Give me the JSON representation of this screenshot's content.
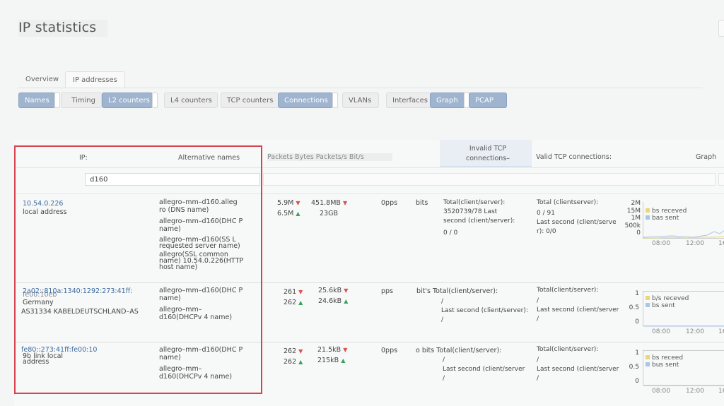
{
  "page": {
    "title": "IP statistics"
  },
  "tabs": [
    {
      "label": "Overview"
    },
    {
      "label": "IP addresses"
    }
  ],
  "buttons": [
    {
      "label": "Names",
      "active": true
    },
    {
      "label": "Timing",
      "active": false
    },
    {
      "label": "L2 counters",
      "active": true
    },
    {
      "label": "L4 counters",
      "active": false
    },
    {
      "label": "TCP counters",
      "active": false
    },
    {
      "label": "Connections",
      "active": true
    },
    {
      "label": "VLANs",
      "active": false
    },
    {
      "label": "Interfaces",
      "active": false
    },
    {
      "label": "Graph",
      "active": true
    },
    {
      "label": "PCAP",
      "active": true
    }
  ],
  "table": {
    "headers": {
      "ip": "IP:",
      "alt": "Alternative names",
      "counters": "Packets Bytes Packets/s Bit/s",
      "invalid": "Invalid TCP connections–",
      "valid": "Valid TCP connections:",
      "graph": "Graph"
    },
    "filter_value": "d160",
    "rows": [
      {
        "ip": "10.54.0.226",
        "ip_sub": "local address",
        "names": [
          "allegro–mm–d160.alleg ro (DNS name)",
          "allegro–mm–d160(DHC P name)",
          "allegro–mm–d160(SS L requested server name)",
          "allegro(SSL common name) 10.54.0.226(HTTP host name)"
        ],
        "packets": [
          "5.9M",
          "6.5M"
        ],
        "bytes": [
          "451.8MB",
          "23GB"
        ],
        "pps": "0pps",
        "bits": "bits",
        "invalid": [
          "Total(client/server):",
          "3520739/78 Last",
          "second (client/server):",
          "0 / 0"
        ],
        "valid": [
          "Total (clientserver):",
          "0 / 91",
          "Last second (client/serve",
          "r): 0/0"
        ],
        "graph_ticks_y": [
          "2M",
          "15M",
          "1M",
          "500k",
          "0"
        ],
        "graph_ticks_x": [
          "08:00",
          "12:00",
          "16"
        ],
        "legend": [
          "bs receved",
          "bas sent"
        ]
      },
      {
        "ip": "2a02::810a:1340:1292:273:41ff:",
        "ip_over": "fe00:10eb",
        "ip_sub": "Germany",
        "ip_sub2": "AS31334 KABELDEUTSCHLAND–AS",
        "names": [
          "allegro–mm–d160(DHC P name)",
          "allegro–mm–d160(DHCPv 4 name)"
        ],
        "packets": [
          "261",
          "262"
        ],
        "bytes": [
          "25.6kB",
          "24.6kB"
        ],
        "pps": "pps",
        "bits": "bit's Total(client/server):",
        "invalid": [
          "/",
          "Last second (client/server):",
          "/"
        ],
        "valid": [
          "Total(client/server):",
          "/",
          "Last second (client/server",
          "/"
        ],
        "graph_ticks_y": [
          "1",
          "0.5",
          "0"
        ],
        "graph_ticks_x": [
          "08:00",
          "12:00",
          "16"
        ],
        "legend": [
          "b/s receved",
          "bs sent"
        ]
      },
      {
        "ip": "fe80::273:41ff:fe00:10",
        "ip_over": "9b link local",
        "ip_sub": "address",
        "names": [
          "allegro–mm–d160(DHC P name)",
          "allegro–mm–d160(DHCPv 4 name)"
        ],
        "packets": [
          "262",
          "262"
        ],
        "bytes": [
          "21.5kB",
          "215kB"
        ],
        "pps": "0pps",
        "bits": "o bits Total(client/server):",
        "invalid": [
          "/",
          "Last second (client/server",
          "/"
        ],
        "valid": [
          "Total(client/server):",
          "/",
          "Last second (client/server",
          "/"
        ],
        "graph_ticks_y": [
          "1",
          "0.5",
          "0"
        ],
        "graph_ticks_x": [
          "08:00",
          "12:00",
          "16"
        ],
        "legend": [
          "bs receed",
          "bus sent"
        ]
      }
    ]
  },
  "colors": {
    "accent": "#9fb4cf",
    "highlight": "#d9434f",
    "received": "#e8d87a",
    "sent": "#a9c6e8"
  }
}
